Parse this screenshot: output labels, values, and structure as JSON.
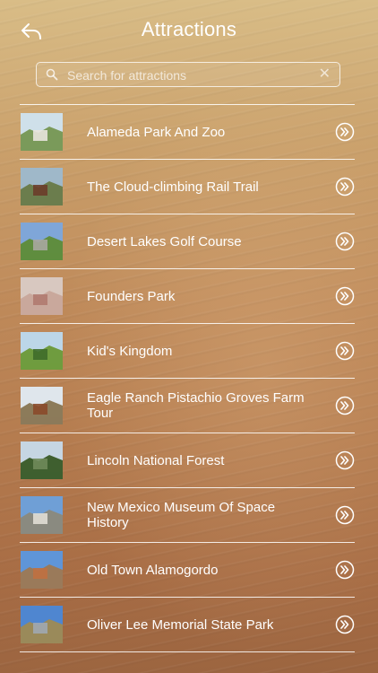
{
  "header": {
    "title": "Attractions",
    "back_icon": "back-arrow-icon"
  },
  "search": {
    "placeholder": "Search for attractions",
    "value": ""
  },
  "attractions": [
    {
      "name": "Alameda Park And Zoo",
      "thumb": {
        "sky": "#cfe0ea",
        "ground": "#7a9a5a",
        "accent": "#e8e4dc"
      }
    },
    {
      "name": "The Cloud-climbing Rail Trail",
      "thumb": {
        "sky": "#9fb8c9",
        "ground": "#6b7d4d",
        "accent": "#6b3d2a"
      }
    },
    {
      "name": "Desert Lakes Golf Course",
      "thumb": {
        "sky": "#7fa6d8",
        "ground": "#5f8d3f",
        "accent": "#a9a7a0"
      }
    },
    {
      "name": "Founders Park",
      "thumb": {
        "sky": "#d8c8c0",
        "ground": "#c9a89c",
        "accent": "#b07a70"
      }
    },
    {
      "name": "Kid's Kingdom",
      "thumb": {
        "sky": "#bcd6e8",
        "ground": "#6f9c3f",
        "accent": "#3f6d2a"
      }
    },
    {
      "name": "Eagle Ranch Pistachio Groves Farm Tour",
      "thumb": {
        "sky": "#dfe6ec",
        "ground": "#8c7b5a",
        "accent": "#8a4a2a"
      }
    },
    {
      "name": "Lincoln National Forest",
      "thumb": {
        "sky": "#c6d6e3",
        "ground": "#3f5f2f",
        "accent": "#6f8a5a"
      }
    },
    {
      "name": "New Mexico Museum Of Space History",
      "thumb": {
        "sky": "#6f9fd6",
        "ground": "#8a8a80",
        "accent": "#e0ddd4"
      }
    },
    {
      "name": "Old Town Alamogordo",
      "thumb": {
        "sky": "#5f95d8",
        "ground": "#9a7a5a",
        "accent": "#c07040"
      }
    },
    {
      "name": "Oliver Lee Memorial State Park",
      "thumb": {
        "sky": "#4f86d0",
        "ground": "#9a8a5a",
        "accent": "#a0a7b0"
      }
    }
  ],
  "row_action_icon": "double-chevron-right-icon"
}
